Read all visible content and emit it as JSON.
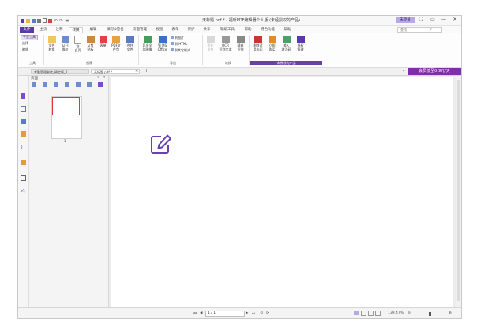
{
  "window": {
    "title": "无标题.pdf * - 福昕PDF编辑器个人版 (未经授权的产品)",
    "login_label": "未登录",
    "controls": [
      "⛶",
      "▭",
      "—",
      "✕"
    ]
  },
  "menu": {
    "tabs": [
      "文件",
      "主页",
      "注释",
      "转换",
      "编辑",
      "填写&签名",
      "页面管理",
      "视图",
      "表单",
      "保护",
      "共享",
      "辅助工具",
      "帮助",
      "特色功能",
      "帮助"
    ],
    "active_tab": "转换",
    "search_placeholder": "查找"
  },
  "ribbon": {
    "tools_group": {
      "items": [
        "手型工具",
        "选择",
        "缩放"
      ],
      "label": "工具"
    },
    "create_group": {
      "buttons": [
        "文件\n转换",
        "从扫\n描仪",
        "空\n白页",
        "从剪\n贴板",
        "表单",
        "PDF文\n件包",
        "合并\n文件"
      ],
      "label": "创建"
    },
    "export_group": {
      "buttons": [
        "导出全\n部图像",
        "到 MS\nOffice"
      ],
      "small": [
        "到图片",
        "到 HTML",
        "到其它格式"
      ],
      "label": "导出"
    },
    "convert_group": {
      "buttons": [
        "优化\n文件",
        "OCR\n识别文本",
        "疑难\n识别"
      ],
      "label": "转换"
    },
    "license_group": {
      "buttons": [
        "删除试\n用水印",
        "立即\n购买",
        "输入\n激活码",
        "授权\n管理"
      ],
      "label": "未授权的产品"
    }
  },
  "doc_tabs": [
    {
      "label": "考勤管理制度_确定版_2...",
      "active": false
    },
    {
      "label": "无标题.pdf *",
      "active": true
    }
  ],
  "promo_text": "会员低至0.9元/天",
  "pages_panel": {
    "title": "页面",
    "page_number": "1"
  },
  "status": {
    "page_value": "1 / 1",
    "zoom": "139.47%"
  }
}
